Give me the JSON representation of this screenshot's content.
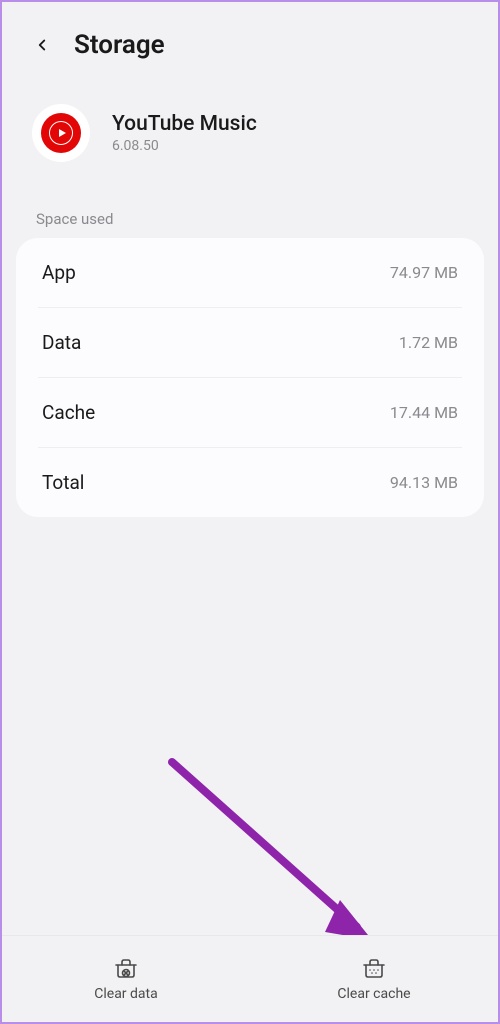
{
  "header": {
    "title": "Storage"
  },
  "app": {
    "name": "YouTube Music",
    "version": "6.08.50"
  },
  "sections": {
    "space_used": {
      "header": "Space used",
      "rows": [
        {
          "label": "App",
          "value": "74.97 MB"
        },
        {
          "label": "Data",
          "value": "1.72 MB"
        },
        {
          "label": "Cache",
          "value": "17.44 MB"
        },
        {
          "label": "Total",
          "value": "94.13 MB"
        }
      ]
    }
  },
  "bottom_actions": {
    "clear_data": "Clear data",
    "clear_cache": "Clear cache"
  },
  "annotation": {
    "color": "#8e24aa"
  }
}
